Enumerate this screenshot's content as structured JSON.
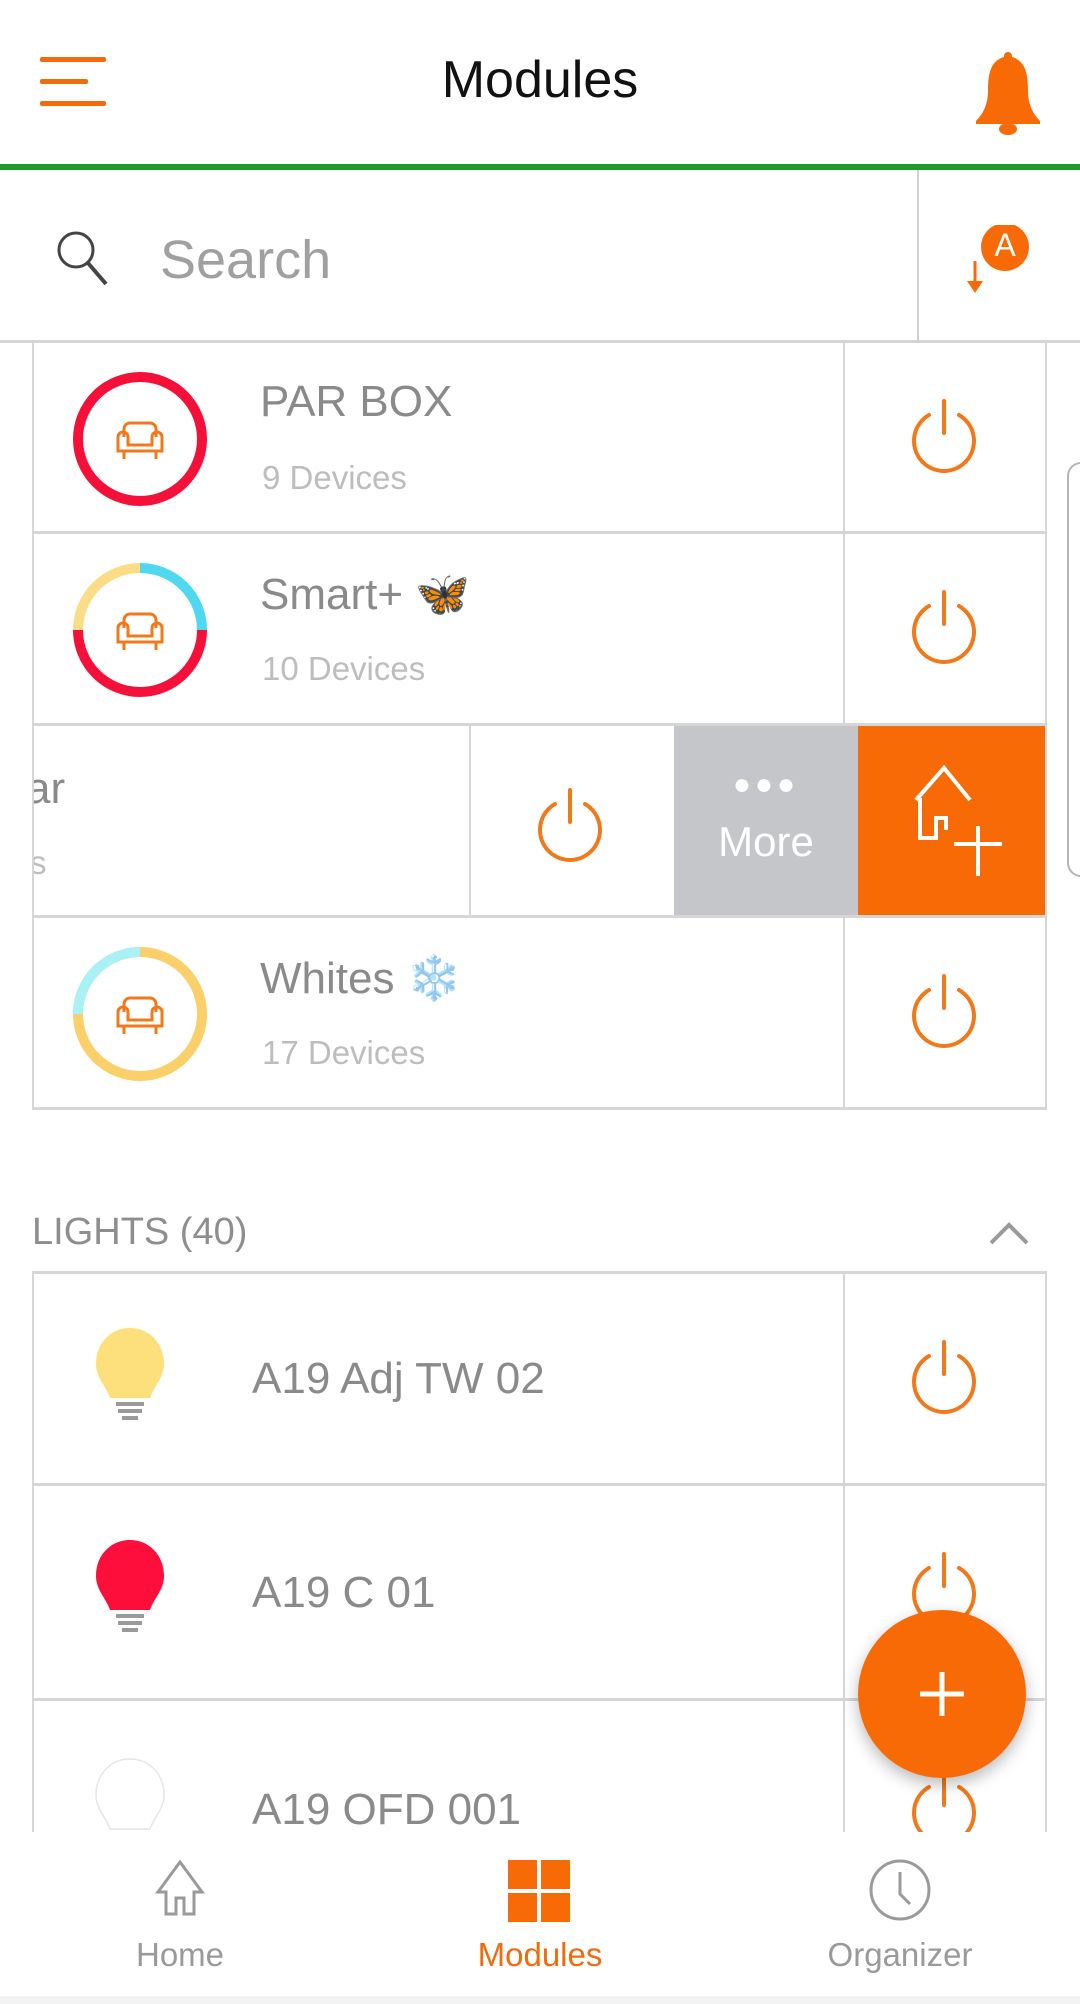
{
  "header": {
    "title": "Modules",
    "menu_icon": "hamburger-menu-icon",
    "notification_icon": "bell-icon"
  },
  "search": {
    "placeholder": "Search",
    "value": "",
    "sort_icon": "sort-alphabetical-icon",
    "sort_badge": "A"
  },
  "rooms": [
    {
      "name": "PAR BOX",
      "emoji": "",
      "devices": "9 Devices",
      "ring_colors": [
        "#f5103a"
      ]
    },
    {
      "name": "Smart+",
      "emoji": "🦋",
      "devices": "10 Devices",
      "ring_colors": [
        "#f5103a",
        "#fbdc87",
        "#4fd8f0"
      ]
    },
    {
      "name_partial": "ar",
      "devices_partial": "s",
      "swiped": true
    },
    {
      "name": "Whites",
      "emoji": "❄️",
      "devices": "17 Devices",
      "ring_colors": [
        "#fbcf6a",
        "#a8f1f5"
      ]
    }
  ],
  "swipe_actions": {
    "more_label": "More",
    "more_icon": "more-dots-icon",
    "add_icon": "add-to-home-icon"
  },
  "lights": {
    "header": "LIGHTS (40)",
    "collapse_icon": "chevron-up-icon",
    "items": [
      {
        "name": "A19 Adj TW 02",
        "bulb_color": "#fde07c"
      },
      {
        "name": "A19 C 01",
        "bulb_color": "#fd0e3b"
      },
      {
        "name": "A19 OFD 001",
        "bulb_color": "#ffffff"
      }
    ]
  },
  "fab": {
    "icon": "plus-icon"
  },
  "bottom_nav": {
    "items": [
      {
        "label": "Home",
        "icon": "home-icon",
        "active": false
      },
      {
        "label": "Modules",
        "icon": "modules-grid-icon",
        "active": true
      },
      {
        "label": "Organizer",
        "icon": "clock-icon",
        "active": false
      }
    ]
  },
  "colors": {
    "accent": "#f86a05",
    "header_underline": "#1f9a2a",
    "more_bg": "#c4c6c9"
  }
}
